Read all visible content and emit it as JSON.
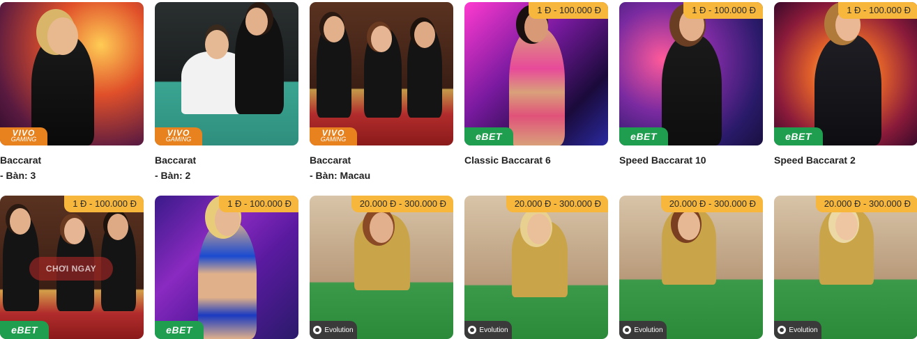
{
  "games": [
    {
      "title": "Baccarat",
      "subtitle": "- Bàn: 3",
      "provider": "vivo",
      "price": ""
    },
    {
      "title": "Baccarat",
      "subtitle": "- Bàn: 2",
      "provider": "vivo",
      "price": ""
    },
    {
      "title": "Baccarat",
      "subtitle": "- Bàn: Macau",
      "provider": "vivo",
      "price": ""
    },
    {
      "title": "Classic Baccarat 6",
      "subtitle": "",
      "provider": "ebet",
      "price": "1 Đ - 100.000 Đ"
    },
    {
      "title": "Speed Baccarat 10",
      "subtitle": "",
      "provider": "ebet",
      "price": "1 Đ - 100.000 Đ"
    },
    {
      "title": "Speed Baccarat 2",
      "subtitle": "",
      "provider": "ebet",
      "price": "1 Đ - 100.000 Đ"
    },
    {
      "title": "",
      "subtitle": "",
      "provider": "ebet",
      "price": "1 Đ - 100.000 Đ",
      "overlay": "CHƠI NGAY"
    },
    {
      "title": "",
      "subtitle": "",
      "provider": "ebet",
      "price": "1 Đ - 100.000 Đ"
    },
    {
      "title": "",
      "subtitle": "",
      "provider": "evolution",
      "price": "20.000 Đ - 300.000 Đ"
    },
    {
      "title": "",
      "subtitle": "",
      "provider": "evolution",
      "price": "20.000 Đ - 300.000 Đ"
    },
    {
      "title": "",
      "subtitle": "",
      "provider": "evolution",
      "price": "20.000 Đ - 300.000 Đ"
    },
    {
      "title": "",
      "subtitle": "",
      "provider": "evolution",
      "price": "20.000 Đ - 300.000 Đ"
    }
  ],
  "providers": {
    "vivo": {
      "line1": "VIVO",
      "line2": "GAMING"
    },
    "ebet": {
      "label": "eBET"
    },
    "evolution": {
      "label": "Evolution",
      "icon": "evolution-logo-icon"
    }
  },
  "colors": {
    "price_badge": "#f6b73c",
    "vivo": "#e8821e",
    "ebet": "#1e9e4e",
    "evolution": "#3a3a3a"
  }
}
